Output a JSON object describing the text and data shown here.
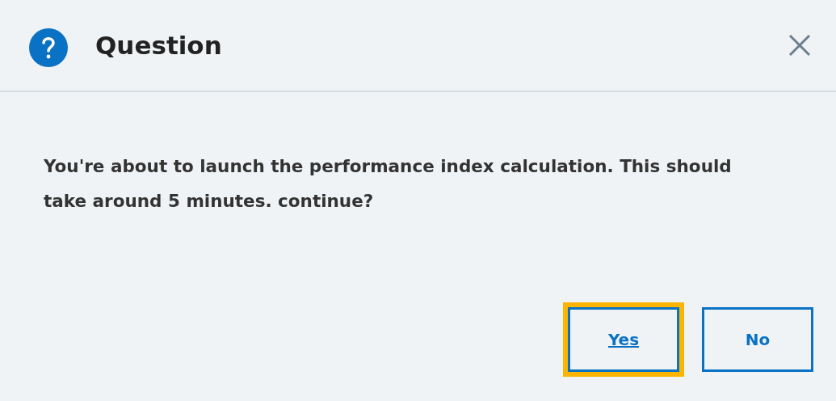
{
  "dialog": {
    "title": "Question",
    "message": "You're about to launch the performance index calculation. This should take around 5 minutes. continue?"
  },
  "buttons": [
    {
      "label": "Yes",
      "focused": true
    },
    {
      "label": "No",
      "focused": false
    }
  ]
}
